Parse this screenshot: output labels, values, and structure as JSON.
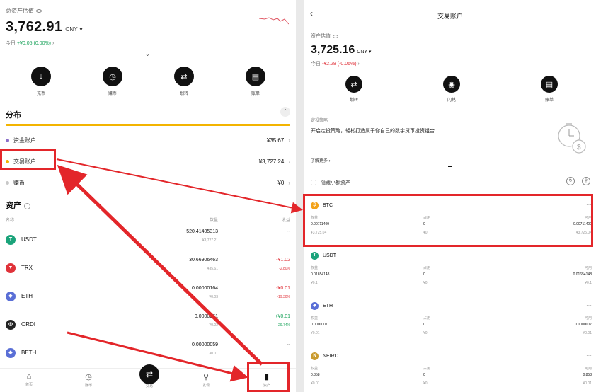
{
  "left": {
    "total_label": "总资产估值",
    "total_value": "3,762.91",
    "currency": "CNY",
    "today_prefix": "今日",
    "today_change": "+¥0.05 (0.00%)",
    "actions": [
      {
        "label": "充币",
        "icon": "deposit-icon",
        "glyph": "↓"
      },
      {
        "label": "赚币",
        "icon": "earn-icon",
        "glyph": "◷"
      },
      {
        "label": "划转",
        "icon": "transfer-icon",
        "glyph": "⇄"
      },
      {
        "label": "账单",
        "icon": "bill-icon",
        "glyph": "▤"
      }
    ],
    "distribution_title": "分布",
    "distribution": [
      {
        "name": "资金账户",
        "value": "¥35.67",
        "color": "#8a6fc9"
      },
      {
        "name": "交易账户",
        "value": "¥3,727.24",
        "color": "#f3b400"
      },
      {
        "name": "赚币",
        "value": "¥0",
        "color": "#c8c8c8"
      }
    ],
    "assets_title": "资产",
    "col_name": "名称",
    "col_qty": "数量",
    "col_pnl": "收益",
    "assets": [
      {
        "symbol": "USDT",
        "qty": "520.41405313",
        "value": "¥3,727.21",
        "pnl": "--",
        "pct": "",
        "color": "#1aa37a",
        "glyph": "T",
        "tone": "muted"
      },
      {
        "symbol": "TRX",
        "qty": "30.66906463",
        "value": "¥35.61",
        "pnl": "-¥1.02",
        "pct": "-2.80%",
        "color": "#e0323a",
        "glyph": "▼",
        "tone": "red"
      },
      {
        "symbol": "ETH",
        "qty": "0.00000164",
        "value": "¥0.03",
        "pnl": "-¥0.01",
        "pct": "-19.30%",
        "color": "#5a6fd6",
        "glyph": "◆",
        "tone": "red"
      },
      {
        "symbol": "ORDI",
        "qty": "0.0000961",
        "value": "¥0.02",
        "pnl": "+¥0.01",
        "pct": "+29.74%",
        "color": "#222222",
        "glyph": "◎",
        "tone": "green"
      },
      {
        "symbol": "BETH",
        "qty": "0.00000059",
        "value": "¥0.01",
        "pnl": "--",
        "pct": "",
        "color": "#5a6fd6",
        "glyph": "◆",
        "tone": "muted"
      }
    ],
    "nav": [
      {
        "label": "首页",
        "icon": "home-icon",
        "glyph": "⌂"
      },
      {
        "label": "赚币",
        "icon": "earn-nav-icon",
        "glyph": "◷"
      },
      {
        "label": "交易",
        "icon": "trade-icon",
        "glyph": "⇄"
      },
      {
        "label": "发现",
        "icon": "discover-icon",
        "glyph": "⚲"
      },
      {
        "label": "资产",
        "icon": "wallet-icon",
        "glyph": "▮"
      }
    ]
  },
  "right": {
    "title": "交易账户",
    "bal_label": "资产估值",
    "bal_value": "3,725.16",
    "currency": "CNY",
    "today_prefix": "今日",
    "today_change": "-¥2.28 (-0.06%)",
    "actions": [
      {
        "label": "划转",
        "icon": "transfer-icon",
        "glyph": "⇄"
      },
      {
        "label": "闪兑",
        "icon": "flash-swap-icon",
        "glyph": "◉"
      },
      {
        "label": "账单",
        "icon": "bill-icon",
        "glyph": "▤"
      }
    ],
    "promo_label": "定投策略",
    "promo_text": "开启定投策略，轻松打造属于你自己的数字货币投资组合",
    "promo_more": "了解更多",
    "hide_small": "隐藏小额资产",
    "h_equity": "权益",
    "h_used": "占用",
    "h_avail": "可用",
    "coins": [
      {
        "symbol": "BTC",
        "color": "#f3a21a",
        "glyph": "₿",
        "equity": "0.00711409",
        "used": "0",
        "avail": "0.00711409",
        "fe": "¥3,725.04",
        "fu": "¥0",
        "fa": "¥3,725.04"
      },
      {
        "symbol": "USDT",
        "color": "#1aa37a",
        "glyph": "T",
        "equity": "0.01654148",
        "used": "0",
        "avail": "0.01654148",
        "fe": "¥0.1",
        "fu": "¥0",
        "fa": "¥0.1"
      },
      {
        "symbol": "ETH",
        "color": "#5a6fd6",
        "glyph": "◆",
        "equity": "0.0000007",
        "used": "0",
        "avail": "0.0000007",
        "fe": "¥0.01",
        "fu": "¥0",
        "fa": "¥0.01"
      },
      {
        "symbol": "NEIRO",
        "color": "#c99a2e",
        "glyph": "N",
        "equity": "0.858",
        "used": "0",
        "avail": "0.858",
        "fe": "¥0.01",
        "fu": "¥0",
        "fa": "¥0.01"
      }
    ]
  }
}
